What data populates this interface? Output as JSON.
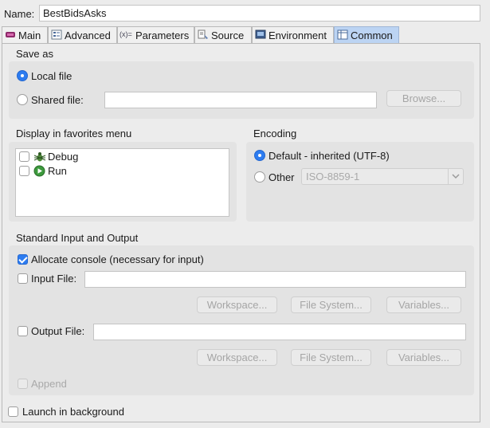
{
  "name_field": {
    "label": "Name:",
    "value": "BestBidsAsks"
  },
  "tabs": [
    {
      "label": "Main",
      "icon": "main-tab-icon"
    },
    {
      "label": "Advanced",
      "icon": "advanced-tab-icon"
    },
    {
      "label": "Parameters",
      "icon": "parameters-tab-icon"
    },
    {
      "label": "Source",
      "icon": "source-tab-icon"
    },
    {
      "label": "Environment",
      "icon": "environment-tab-icon"
    },
    {
      "label": "Common",
      "icon": "common-tab-icon",
      "active": true
    }
  ],
  "save_as": {
    "heading": "Save as",
    "local_label": "Local file",
    "shared_label": "Shared file:",
    "shared_value": "",
    "browse_label": "Browse...",
    "selected": "Local file"
  },
  "favorites": {
    "heading": "Display in favorites menu",
    "items": [
      {
        "label": "Debug",
        "icon": "debug-bug-icon",
        "checked": false
      },
      {
        "label": "Run",
        "icon": "run-play-icon",
        "checked": false
      }
    ]
  },
  "encoding": {
    "heading": "Encoding",
    "default_label": "Default - inherited (UTF-8)",
    "other_label": "Other",
    "other_value": "ISO-8859-1",
    "selected": "Default - inherited (UTF-8)"
  },
  "std_io": {
    "heading": "Standard Input and Output",
    "allocate_label": "Allocate console (necessary for input)",
    "allocate_checked": true,
    "input_label": "Input File:",
    "input_value": "",
    "output_label": "Output File:",
    "output_value": "",
    "workspace_label": "Workspace...",
    "filesystem_label": "File System...",
    "variables_label": "Variables...",
    "append_label": "Append"
  },
  "launch_background": {
    "label": "Launch in background",
    "checked": false
  },
  "colors": {
    "accent": "#2d7cf0",
    "active_tab": "#bcd4f3",
    "group_bg": "#e3e3e3"
  }
}
